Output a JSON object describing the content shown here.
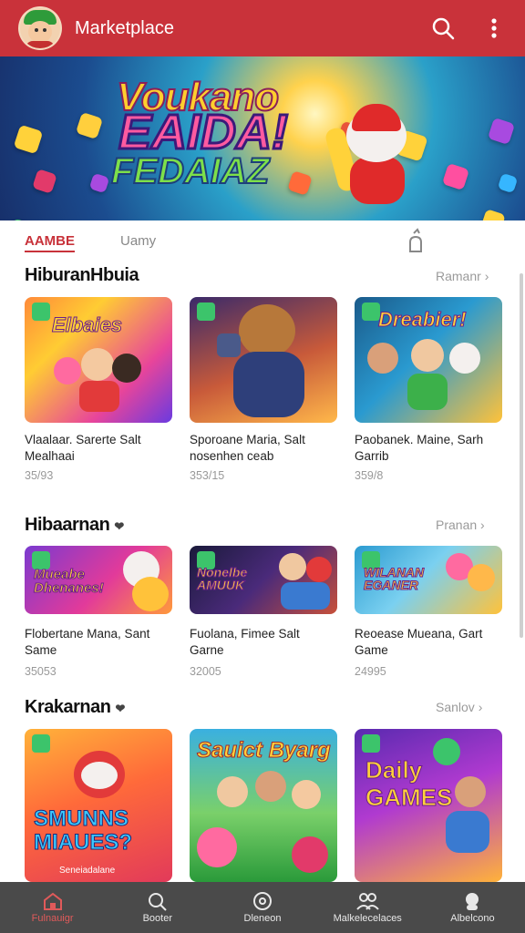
{
  "app": {
    "title": "Marketplace"
  },
  "banner": {
    "line1": "Voukano",
    "line2": "EAIDA!",
    "line3": "FEDAIAZ"
  },
  "tabs": [
    {
      "label": "AAMBE"
    },
    {
      "label": "Uamy"
    }
  ],
  "sections": [
    {
      "title": "HiburanHbuia",
      "more": "Ramanr",
      "items": [
        {
          "thumb_text": "Elbaies",
          "title": "Vlaalaar. Sarerte Salt Mealhaai",
          "meta": "35/93"
        },
        {
          "thumb_text": "",
          "title": "Sporoane Maria, Salt nosenhen ceab",
          "meta": "353/15"
        },
        {
          "thumb_text": "Dreabier!",
          "title": "Paobanek. Maine, Sarh Garrib",
          "meta": "359/8"
        }
      ]
    },
    {
      "title": "Hibaarnan",
      "more": "Pranan",
      "items": [
        {
          "thumb_text": "Mueabe Dhenanes!",
          "title": "Flobertane Mana, Sant Same",
          "meta": "35053"
        },
        {
          "thumb_text": "Nonelbe AMUUK",
          "title": "Fuolana, Fimee Salt Garne",
          "meta": "32005"
        },
        {
          "thumb_text": "WILANAN EGANER",
          "title": "Reoease Mueana, Gart Game",
          "meta": "24995"
        }
      ]
    },
    {
      "title": "Krakarnan",
      "more": "Sanlov",
      "items": [
        {
          "thumb_text": "SMUNNS MIAUES?",
          "title": "",
          "meta": ""
        },
        {
          "thumb_text": "Sauict Byarg",
          "title": "",
          "meta": ""
        },
        {
          "thumb_text": "Daily GAMES",
          "title": "",
          "meta": ""
        }
      ]
    }
  ],
  "thumb_caption_bottom": "Seneiadalane",
  "nav": [
    {
      "label": "Fulnauigr",
      "icon": "home-icon",
      "active": true
    },
    {
      "label": "Booter",
      "icon": "search-icon"
    },
    {
      "label": "Dleneon",
      "icon": "compass-icon"
    },
    {
      "label": "Malkelecelaces",
      "icon": "people-icon"
    },
    {
      "label": "Albelcono",
      "icon": "profile-icon"
    }
  ],
  "colors": {
    "primary": "#c9323a",
    "nav_bg": "#4a4a4a"
  }
}
